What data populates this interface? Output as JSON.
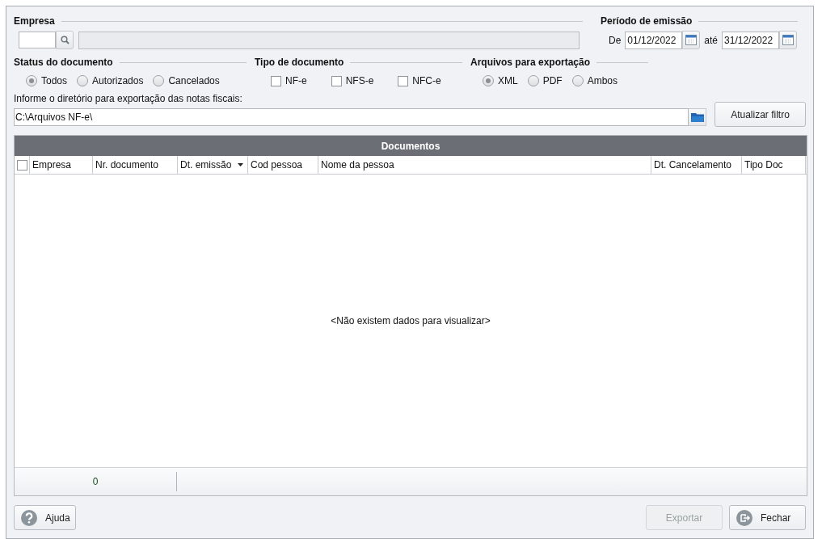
{
  "empresa": {
    "label": "Empresa"
  },
  "periodo": {
    "label": "Período de emissão",
    "from_label": "De",
    "from_value": "01/12/2022",
    "to_label": "até",
    "to_value": "31/12/2022"
  },
  "status": {
    "label": "Status do documento",
    "options": [
      {
        "label": "Todos",
        "selected": true
      },
      {
        "label": "Autorizados",
        "selected": false
      },
      {
        "label": "Cancelados",
        "selected": false
      }
    ]
  },
  "tipo": {
    "label": "Tipo de documento",
    "options": [
      {
        "label": "NF-e",
        "checked": false
      },
      {
        "label": "NFS-e",
        "checked": false
      },
      {
        "label": "NFC-e",
        "checked": false
      }
    ]
  },
  "arquivos": {
    "label": "Arquivos para exportação",
    "options": [
      {
        "label": "XML",
        "selected": true
      },
      {
        "label": "PDF",
        "selected": false
      },
      {
        "label": "Ambos",
        "selected": false
      }
    ]
  },
  "diretorio": {
    "label": "Informe o diretório para exportação das notas fiscais:",
    "value": "C:\\Arquivos NF-e\\"
  },
  "update_button": "Atualizar filtro",
  "grid": {
    "title": "Documentos",
    "select_all_checked": false,
    "columns": [
      {
        "label": "Empresa",
        "sorted": false
      },
      {
        "label": "Nr. documento",
        "sorted": false
      },
      {
        "label": "Dt. emissão",
        "sorted": true
      },
      {
        "label": "Cod pessoa",
        "sorted": false
      },
      {
        "label": "Nome da pessoa",
        "sorted": false
      },
      {
        "label": "Dt. Cancelamento",
        "sorted": false
      },
      {
        "label": "Tipo Doc",
        "sorted": false
      }
    ],
    "empty_text": "<Não existem dados para visualizar>",
    "footer_count": "0"
  },
  "buttons": [
    {
      "label": "Ajuda",
      "kind": "help",
      "disabled": false
    },
    {
      "label": "Exportar",
      "kind": "plain",
      "disabled": true
    },
    {
      "label": "Fechar",
      "kind": "exit",
      "disabled": false
    }
  ]
}
